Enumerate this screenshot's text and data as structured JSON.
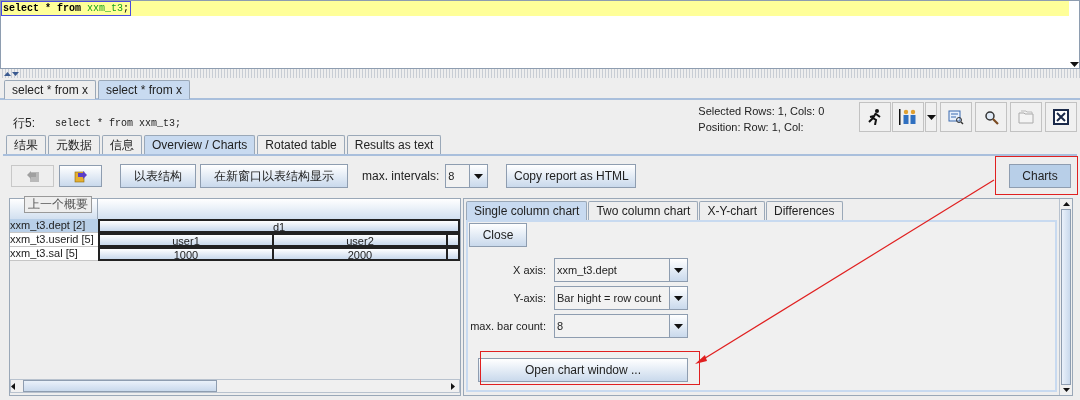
{
  "editor": {
    "tokens": [
      {
        "text": "select * from ",
        "kind": "keyword"
      },
      {
        "text": "xxm_t3",
        "kind": "identifier"
      },
      {
        "text": ";",
        "kind": "plain"
      }
    ]
  },
  "result_tabs": [
    {
      "label": "select * from x",
      "selected": false
    },
    {
      "label": "select * from x",
      "selected": true
    }
  ],
  "statement": {
    "label": "行5:",
    "sql": "select * from xxm_t3;"
  },
  "status": [
    "Selected Rows: 1, Cols: 0",
    "Position: Row: 1, Col:"
  ],
  "view_tabs": [
    {
      "label": "结果",
      "selected": false
    },
    {
      "label": "元数据",
      "selected": false
    },
    {
      "label": "信息",
      "selected": false
    },
    {
      "label": "Overview / Charts",
      "selected": true
    },
    {
      "label": "Rotated table",
      "selected": false
    },
    {
      "label": "Results as text",
      "selected": false
    }
  ],
  "overview_toolbar": {
    "nav": [
      {
        "kind": "back",
        "disabled": true
      },
      {
        "kind": "forward",
        "disabled": false
      }
    ],
    "buttons": [
      "以表结构",
      "在新窗口以表结构显示"
    ],
    "max_intervals": {
      "label": "max. intervals:",
      "value": "8"
    },
    "copy_button": "Copy report as HTML",
    "charts_button": "Charts"
  },
  "tooltip": "上一个概要",
  "table": {
    "rows": [
      {
        "label": "xxm_t3.dept [2]",
        "selected": true,
        "cells": [
          "d1"
        ]
      },
      {
        "label": "xxm_t3.userid [5]",
        "selected": false,
        "cells": [
          "user1",
          "user2"
        ]
      },
      {
        "label": "xxm_t3.sal [5]",
        "selected": false,
        "cells": [
          "1000",
          "2000"
        ]
      }
    ]
  },
  "chart_panel": {
    "tabs": [
      {
        "label": "Single column chart",
        "selected": true
      },
      {
        "label": "Two column chart",
        "selected": false
      },
      {
        "label": "X-Y-chart",
        "selected": false
      },
      {
        "label": "Differences",
        "selected": false
      }
    ],
    "close_button": "Close",
    "fields": [
      {
        "label": "X axis:",
        "value": "xxm_t3.dept"
      },
      {
        "label": "Y-axis:",
        "value": "Bar hight = row count"
      },
      {
        "label": "max. bar count:",
        "value": "8"
      }
    ],
    "open_button": "Open chart window ..."
  }
}
